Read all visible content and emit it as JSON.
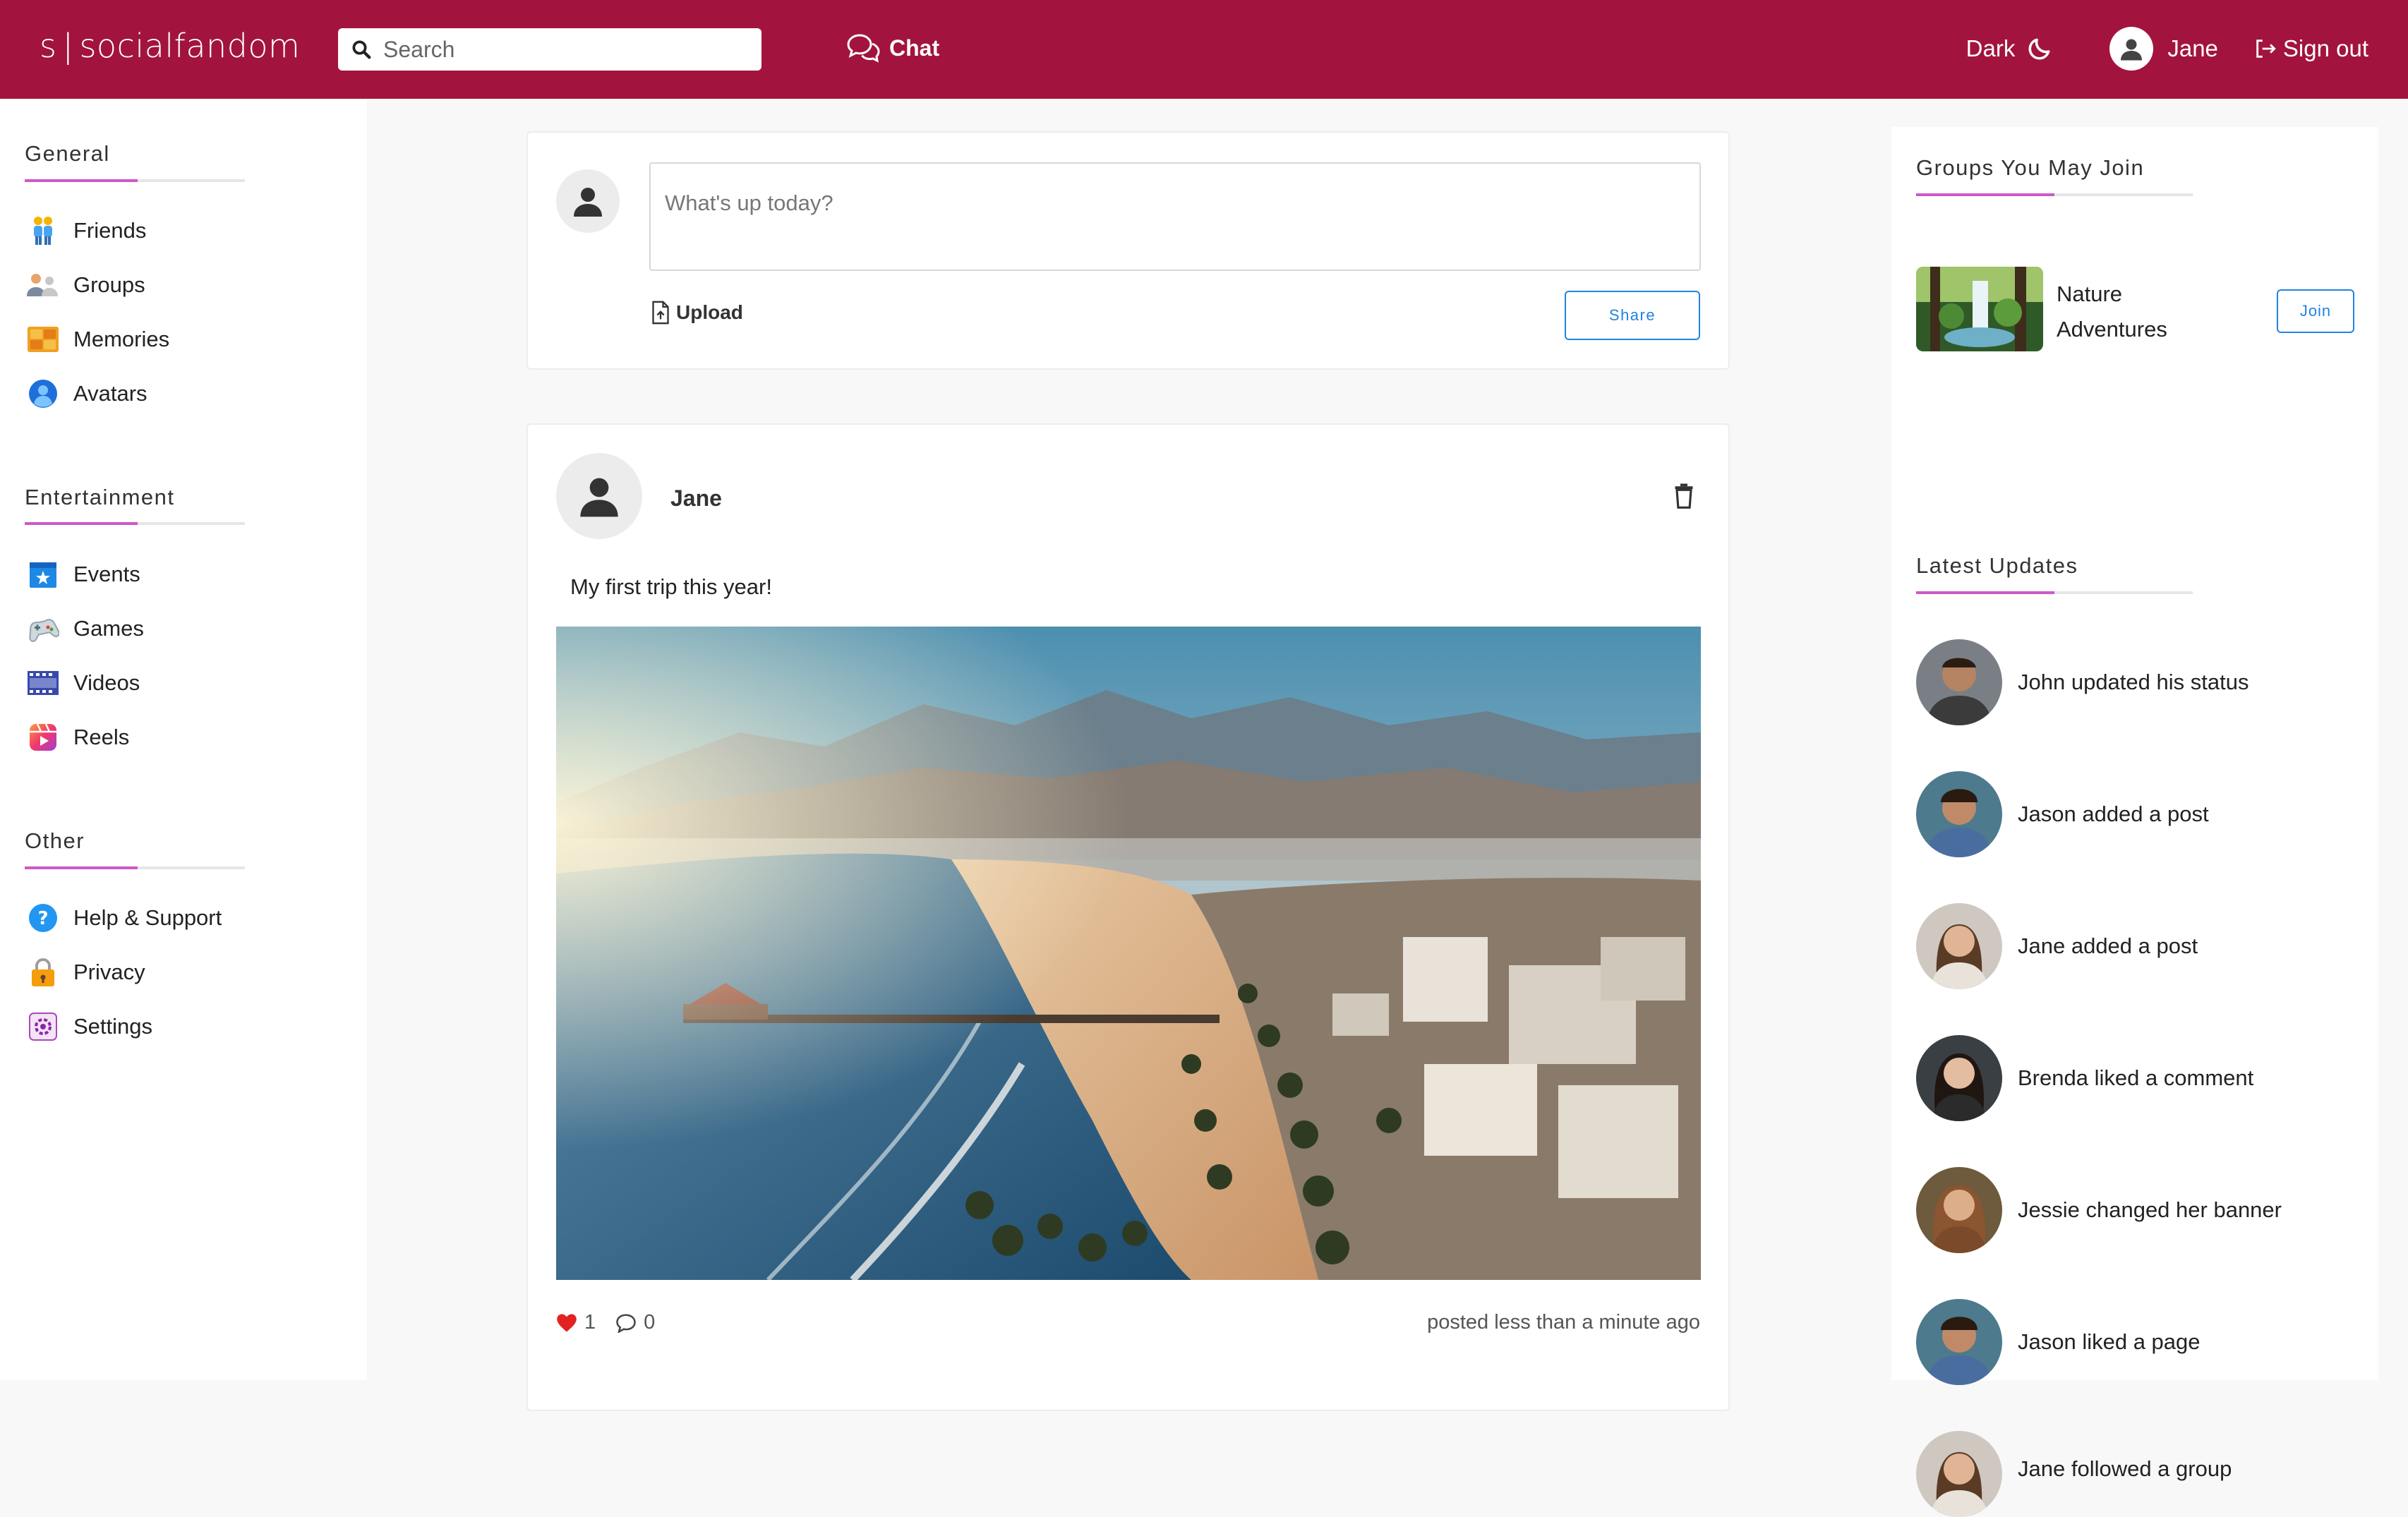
{
  "header": {
    "logo_s": "s",
    "logo_sep": "|",
    "logo_text": "socialfandom",
    "search_placeholder": "Search",
    "chat_label": "Chat",
    "theme_label": "Dark",
    "user_name": "Jane",
    "signout_label": "Sign out"
  },
  "sidebar": {
    "sections": [
      {
        "title": "General",
        "items": [
          {
            "label": "Friends",
            "icon": "friends-icon"
          },
          {
            "label": "Groups",
            "icon": "groups-icon"
          },
          {
            "label": "Memories",
            "icon": "memories-icon"
          },
          {
            "label": "Avatars",
            "icon": "avatars-icon"
          }
        ]
      },
      {
        "title": "Entertainment",
        "items": [
          {
            "label": "Events",
            "icon": "events-icon"
          },
          {
            "label": "Games",
            "icon": "games-icon"
          },
          {
            "label": "Videos",
            "icon": "videos-icon"
          },
          {
            "label": "Reels",
            "icon": "reels-icon"
          }
        ]
      },
      {
        "title": "Other",
        "items": [
          {
            "label": "Help & Support",
            "icon": "help-icon"
          },
          {
            "label": "Privacy",
            "icon": "lock-icon"
          },
          {
            "label": "Settings",
            "icon": "settings-icon"
          }
        ]
      }
    ]
  },
  "composer": {
    "placeholder": "What's up today?",
    "upload_label": "Upload",
    "share_label": "Share"
  },
  "post": {
    "author": "Jane",
    "text": "My first trip this year!",
    "likes": "1",
    "comments": "0",
    "time": "posted less than a minute ago"
  },
  "groups_panel": {
    "title": "Groups You May Join",
    "group_name": "Nature Adventures",
    "join_label": "Join"
  },
  "updates_panel": {
    "title": "Latest Updates",
    "items": [
      "John updated his status",
      "Jason added a post",
      "Jane added a post",
      "Brenda liked a comment",
      "Jessie changed her banner",
      "Jason liked a page",
      "Jane followed a group"
    ]
  },
  "colors": {
    "brand": "#a2143d",
    "accent": "#cc59c7",
    "link": "#2283e0"
  }
}
